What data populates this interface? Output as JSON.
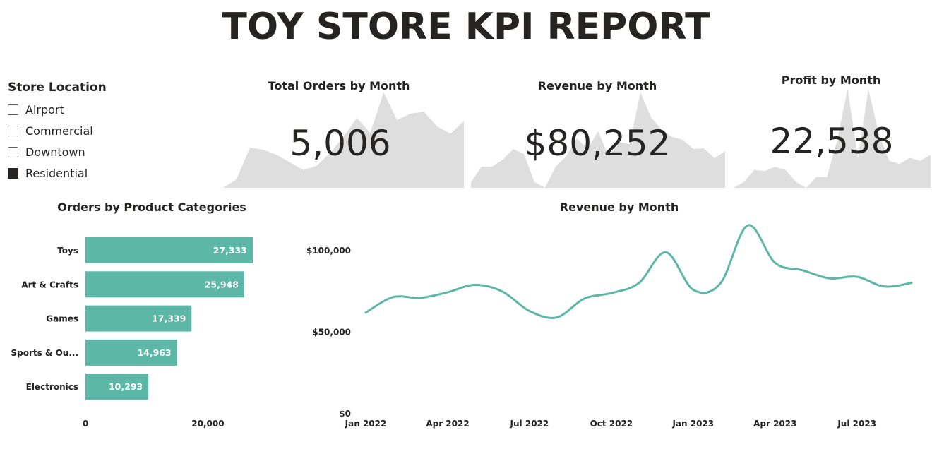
{
  "report_title": "TOY STORE KPI REPORT",
  "slicer": {
    "title": "Store Location",
    "items": [
      {
        "label": "Airport",
        "checked": false
      },
      {
        "label": "Commercial",
        "checked": false
      },
      {
        "label": "Downtown",
        "checked": false
      },
      {
        "label": "Residential",
        "checked": true
      }
    ]
  },
  "colors": {
    "accent": "#5DB7A6",
    "sparkline_fill": "#DEDEDE",
    "text": "#252423"
  },
  "kpi_cards": [
    {
      "title": "Total Orders by Month",
      "value": "5,006",
      "trend": [
        0,
        20,
        95,
        90,
        78,
        60,
        42,
        52,
        83,
        120,
        165,
        130,
        225,
        160,
        175,
        180,
        145,
        128,
        158
      ]
    },
    {
      "title": "Revenue by Month",
      "value": "$80,252",
      "trend": [
        8,
        30,
        30,
        40,
        55,
        48,
        8,
        0,
        30,
        45,
        70,
        55,
        80,
        45,
        65,
        62,
        135,
        100,
        82,
        72,
        68,
        55,
        56,
        42,
        52
      ]
    },
    {
      "title": "Profit by Month",
      "value": "22,538",
      "trend": [
        0,
        10,
        30,
        28,
        35,
        30,
        10,
        0,
        18,
        18,
        80,
        165,
        50,
        165,
        90,
        45,
        40,
        50,
        45,
        55
      ]
    }
  ],
  "chart_data": [
    {
      "type": "bar",
      "title": "Orders by Product Categories",
      "categories": [
        "Toys",
        "Art & Crafts",
        "Games",
        "Sports & Ou...",
        "Electronics"
      ],
      "values": [
        27333,
        25948,
        17339,
        14963,
        10293
      ],
      "value_labels": [
        "27,333",
        "25,948",
        "17,339",
        "14,963",
        "10,293"
      ],
      "x_ticks": [
        0,
        20000
      ],
      "x_tick_labels": [
        "0",
        "20,000"
      ],
      "xlim": [
        0,
        31000
      ],
      "orientation": "horizontal",
      "grid": false
    },
    {
      "type": "line",
      "title": "Revenue by Month",
      "x": [
        "Jan 2022",
        "Feb 2022",
        "Mar 2022",
        "Apr 2022",
        "May 2022",
        "Jun 2022",
        "Jul 2022",
        "Aug 2022",
        "Sep 2022",
        "Oct 2022",
        "Nov 2022",
        "Dec 2022",
        "Jan 2023",
        "Feb 2023",
        "Mar 2023",
        "Apr 2023",
        "May 2023",
        "Jun 2023",
        "Jul 2023",
        "Aug 2023",
        "Sep 2023"
      ],
      "values": [
        62000,
        71500,
        71000,
        74500,
        79000,
        75000,
        63000,
        59000,
        70500,
        74000,
        80000,
        99000,
        76000,
        80000,
        115500,
        92500,
        88000,
        83000,
        84000,
        78000,
        80252
      ],
      "x_tick_labels": [
        "Jan 2022",
        "Apr 2022",
        "Jul 2022",
        "Oct 2022",
        "Jan 2023",
        "Apr 2023",
        "Jul 2023"
      ],
      "x_tick_indices": [
        0,
        3,
        6,
        9,
        12,
        15,
        18
      ],
      "y_ticks": [
        0,
        50000,
        100000
      ],
      "y_tick_labels": [
        "$0",
        "$50,000",
        "$100,000"
      ],
      "ylim": [
        0,
        120000
      ],
      "grid": false
    }
  ]
}
